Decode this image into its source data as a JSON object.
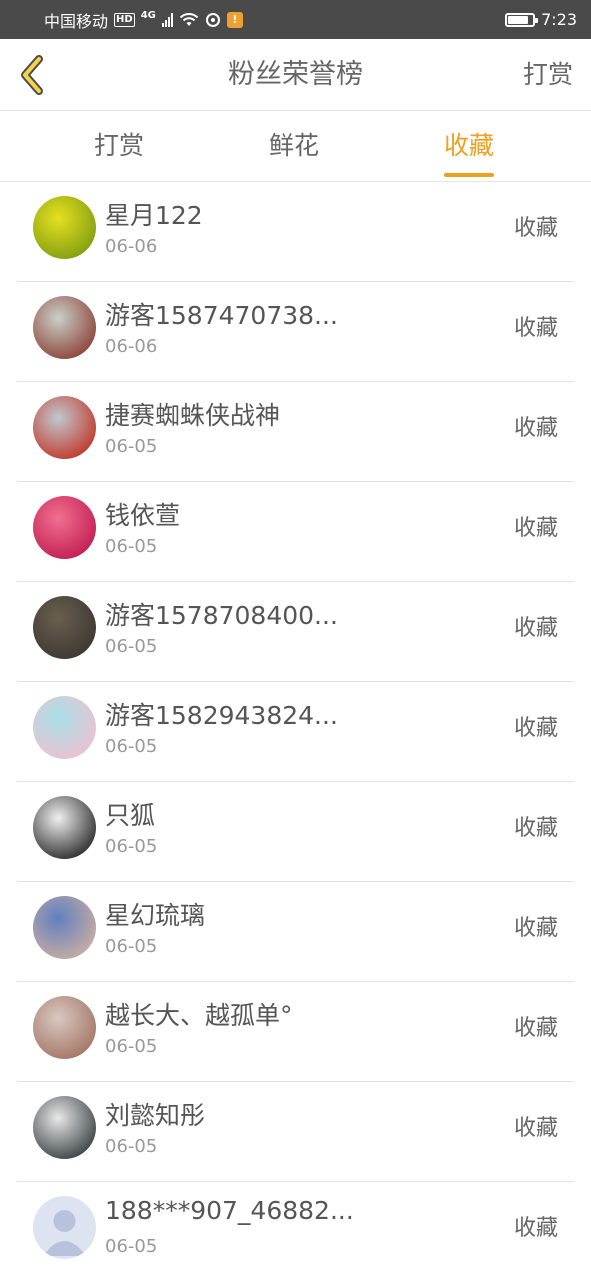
{
  "status_bar": {
    "carrier": "中国移动",
    "hd": "HD",
    "network": "4G",
    "notification_badge": "!",
    "time": "7:23",
    "battery_level": 0.85
  },
  "header": {
    "title": "粉丝荣誉榜",
    "right_link": "打赏"
  },
  "tabs": [
    {
      "label": "打赏",
      "active": false
    },
    {
      "label": "鲜花",
      "active": false
    },
    {
      "label": "收藏",
      "active": true
    }
  ],
  "accent_color": "#f0a020",
  "fans": [
    {
      "name": "星月122",
      "date": "06-06",
      "action": "收藏",
      "avatar_colors": [
        "#e6e020",
        "#7a9a10"
      ]
    },
    {
      "name": "游客1587470738...",
      "date": "06-06",
      "action": "收藏",
      "avatar_colors": [
        "#c8d0c8",
        "#8a3a30"
      ]
    },
    {
      "name": "捷赛蜘蛛侠战神",
      "date": "06-05",
      "action": "收藏",
      "avatar_colors": [
        "#c0c8d0",
        "#c03020"
      ]
    },
    {
      "name": "钱依萱",
      "date": "06-05",
      "action": "收藏",
      "avatar_colors": [
        "#f07090",
        "#c01850"
      ]
    },
    {
      "name": "游客1578708400...",
      "date": "06-05",
      "action": "收藏",
      "avatar_colors": [
        "#6a6050",
        "#3a3530"
      ]
    },
    {
      "name": "游客1582943824...",
      "date": "06-05",
      "action": "收藏",
      "avatar_colors": [
        "#a8e0e8",
        "#f0c0d0"
      ]
    },
    {
      "name": "只狐",
      "date": "06-05",
      "action": "收藏",
      "avatar_colors": [
        "#f0f0f0",
        "#202020"
      ]
    },
    {
      "name": "星幻琉璃",
      "date": "06-05",
      "action": "收藏",
      "avatar_colors": [
        "#6080c0",
        "#d0b0a0"
      ]
    },
    {
      "name": "越长大、越孤单°",
      "date": "06-05",
      "action": "收藏",
      "avatar_colors": [
        "#d8c8c0",
        "#a07060"
      ]
    },
    {
      "name": "刘懿知彤",
      "date": "06-05",
      "action": "收藏",
      "avatar_colors": [
        "#e8e8e8",
        "#303838"
      ]
    },
    {
      "name": "188***907_46882...",
      "date": "06-05",
      "action": "收藏",
      "avatar_colors": [
        "#dde3f0",
        "#b8c2dc"
      ]
    }
  ]
}
